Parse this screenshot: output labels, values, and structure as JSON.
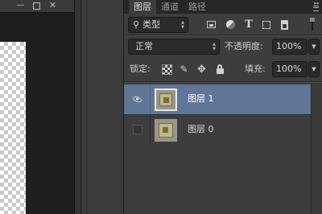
{
  "document": {
    "window_controls": {
      "minimize_label": "—",
      "close_label": "✕"
    }
  },
  "panel": {
    "tabs": [
      {
        "label": "图层",
        "active": true
      },
      {
        "label": "通道",
        "active": false
      },
      {
        "label": "路径",
        "active": false
      }
    ],
    "menu_icon": "panel-menu-icon"
  },
  "filter": {
    "kind_label": "类型",
    "icons": [
      "pixel-filter-icon",
      "adjustment-filter-icon",
      "type-filter-icon",
      "shape-filter-icon",
      "smart-object-filter-icon"
    ],
    "type_glyph": "T"
  },
  "blending": {
    "mode": "正常",
    "opacity_label": "不透明度:",
    "opacity_value": "100%"
  },
  "lock": {
    "label": "锁定:",
    "fill_label": "填充:",
    "fill_value": "100%",
    "icons": [
      "lock-transparent-icon",
      "lock-pixels-icon",
      "lock-position-icon",
      "lock-all-icon"
    ]
  },
  "layers": [
    {
      "name": "图层 1",
      "visible": true,
      "selected": true
    },
    {
      "name": "图层 0",
      "visible": false,
      "selected": false
    }
  ],
  "colors": {
    "panel_bg": "#3d3d3d",
    "selected_row": "#5f7696",
    "field_bg": "#2a2a2a"
  }
}
